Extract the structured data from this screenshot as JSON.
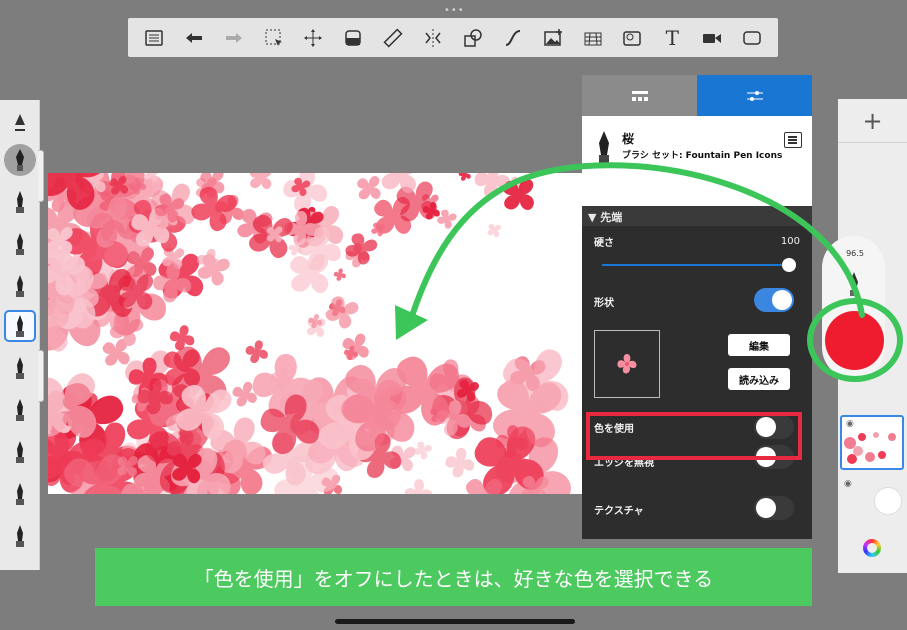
{
  "toolbar": {
    "tools": [
      "menu-icon",
      "undo-icon",
      "redo-icon",
      "selection-icon",
      "transform-icon",
      "fill-icon",
      "ruler-icon",
      "symmetry-icon",
      "shapes-icon",
      "curve-icon",
      "image-icon",
      "perspective-icon",
      "timelapse-icon",
      "text-icon",
      "video-icon",
      "canvas-icon"
    ],
    "text_glyph": "T"
  },
  "panel": {
    "brush_name": "桜",
    "brush_set": "ブラシ セット: Fountain Pen Icons",
    "section_title": "▼ 先端",
    "hardness_label": "硬さ",
    "hardness_value": "100",
    "shape_label": "形状",
    "edit_button": "編集",
    "import_button": "読み込み",
    "use_color_label": "色を使用",
    "ignore_edges_label": "エッジを無視",
    "texture_label": "テクスチャ",
    "shape_toggle": "on",
    "use_color_toggle": "off",
    "ignore_edges_toggle": "off",
    "texture_toggle": "off"
  },
  "side": {
    "plus": "+",
    "brush_size": "96.5"
  },
  "colors": {
    "accent": "#1976d3",
    "current_color": "#ee1c2e",
    "highlight_green": "#3cc65a",
    "highlight_red": "#e8293f",
    "caption_bg": "#4cc95f"
  },
  "caption": "「色を使用」をオフにしたときは、好きな色を選択できる"
}
